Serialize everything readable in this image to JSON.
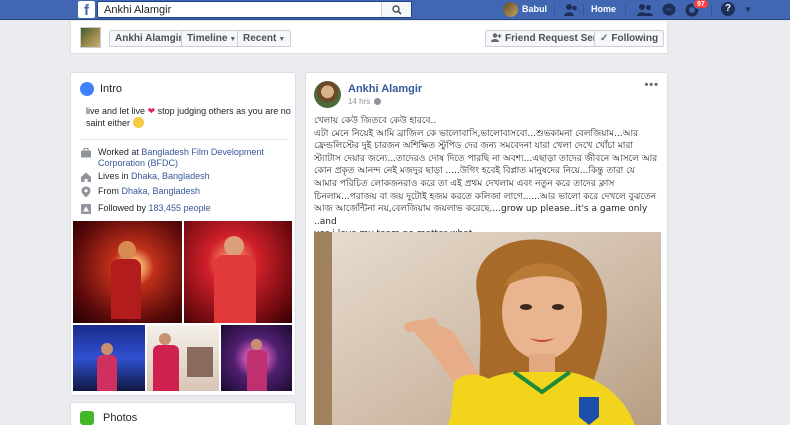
{
  "topbar": {
    "logo": "f",
    "search_value": "Ankhi Alamgir",
    "user_name": "Babul",
    "home_label": "Home",
    "notifications_count": "97",
    "help_label": "?"
  },
  "subbar": {
    "name_tab": "Ankhi Alamgir",
    "timeline_tab": "Timeline",
    "recent_tab": "Recent",
    "friend_request_label": "Friend Request Sent",
    "following_label": "Following"
  },
  "intro": {
    "title": "Intro",
    "bio_part1": "live and let live",
    "bio_part2": "stop judging others as you are no saint either",
    "work_prefix": "Worked at ",
    "work_place": "Bangladesh Film Development Corporation (BFDC)",
    "lives_prefix": "Lives in ",
    "lives_place": "Dhaka, Bangladesh",
    "from_prefix": "From ",
    "from_place": "Dhaka, Bangladesh",
    "followed_prefix": "Followed by ",
    "followed_count": "183,455 people"
  },
  "photos": {
    "title": "Photos"
  },
  "post": {
    "author": "Ankhi Alamgir",
    "time": "14 hrs",
    "lines": [
      "খেলায় কেউ জিতবে কেউ হারবে..",
      "এটা মেনে নিয়েই আমি ব্রাজিল কে ভালোবাসি,ভালোবাসবো...শুভকামনা বেলজিয়াম...আর",
      "ফ্রেন্ডলিস্টের দুই চারজন অশিক্ষিত স্টুপিড দের জন্য সমবেদনা যারা খেলা দেখে খোঁচা মারা",
      "স্ট্যাটাস দেয়ার জন্যে...তাদেরও দোষ দিতে পারছি না অবশ্য...এছাড়া তাদের জীবনে আসলে আর",
      "কোন প্রকৃত আনন্দ নেই মজদুর ছাড়া .....উগিং হবেই বিপ্লাত মানুষদের নিয়ে...কিন্তু তারা যে",
      "আমার পরিচিত লোকজনরাও করে তা এই প্রথম দেখলাম এবং নতুন করে তাদের ক্লাস",
      "চিনলাম...পরাজয় বা জয় দুটোই হজম করতে কলিজা লাগে......আর ভালো করে দেখলে বুঝতেন",
      "আজ আর্জেন্টিনা নয়,বেলজিয়াম জয়লাভ করেছে....grow up please..it's a game only ..and",
      "yes i love my team no matter what ....."
    ]
  },
  "colors": {
    "brand_blue": "#4267b2",
    "link_blue": "#365899",
    "badge_red": "#fa3e3e"
  }
}
